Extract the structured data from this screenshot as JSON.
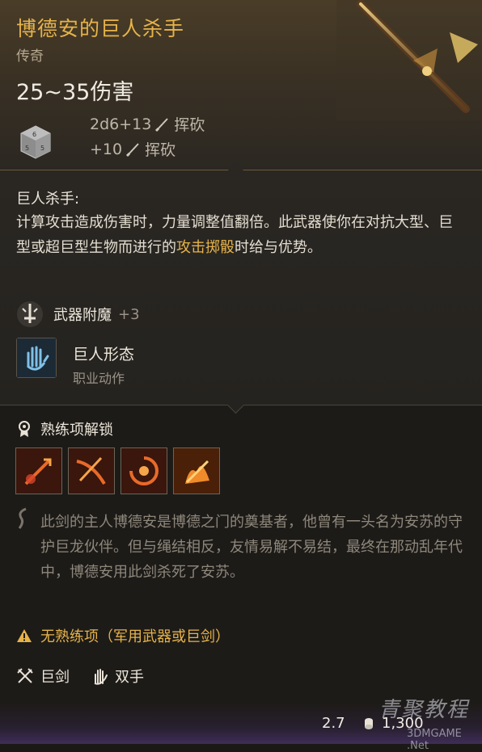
{
  "item": {
    "name": "博德安的巨人杀手",
    "rarity": "传奇",
    "damage": "25~35伤害",
    "damage_lines": [
      {
        "dice": "2d6+13",
        "type": "挥砍"
      },
      {
        "bonus": "+10",
        "type": "挥砍"
      }
    ]
  },
  "feature": {
    "title": "巨人杀手:",
    "desc_before": "计算攻击造成伤害时，力量调整值翻倍。此武器使你在对抗大型、巨型或超巨型生物而进行的",
    "desc_highlight": "攻击掷骰",
    "desc_after": "时给与优势。"
  },
  "enchant": {
    "label": "武器附魔",
    "bonus": "+3"
  },
  "action": {
    "name": "巨人形态",
    "sub": "职业动作"
  },
  "proficiency": {
    "label": "熟练项解锁",
    "slots": [
      "prof-1",
      "prof-2",
      "prof-3",
      "prof-4"
    ]
  },
  "lore": "此剑的主人博德安是博德之门的奠基者，他曾有一头名为安苏的守护巨龙伙伴。但与绳结相反，友情易解不易结，最终在那动乱年代中，博德安用此剑杀死了安苏。",
  "warning": "无熟练项（军用武器或巨剑）",
  "tags": [
    {
      "label": "巨剑",
      "icon": "crossed-swords-icon"
    },
    {
      "label": "双手",
      "icon": "hand-icon"
    }
  ],
  "footer": {
    "weight": "2.7",
    "price": "1,300"
  },
  "watermark": {
    "main": "青聚教程",
    "sub": "3DMGAME   .Net"
  },
  "colors": {
    "gold": "#e6b34a",
    "text": "#ece6da",
    "muted": "#8e877b"
  }
}
